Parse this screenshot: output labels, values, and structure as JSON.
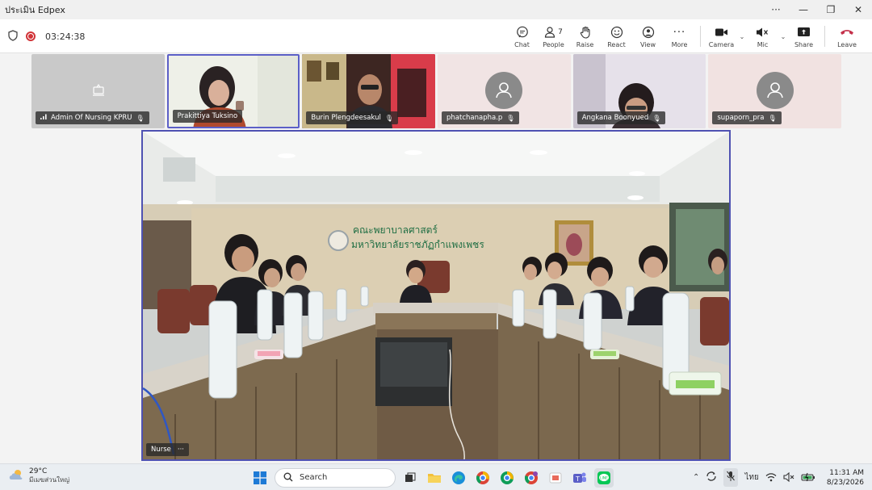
{
  "window": {
    "title": "ประเมิน Edpex",
    "controls": {
      "more": "···",
      "minimize": "—",
      "restore": "❐",
      "close": "✕"
    }
  },
  "toolbar": {
    "timer": "03:24:38",
    "chat_label": "Chat",
    "people_label": "People",
    "people_count": "7",
    "raise_label": "Raise",
    "react_label": "React",
    "view_label": "View",
    "more_label": "More",
    "camera_label": "Camera",
    "mic_label": "Mic",
    "share_label": "Share",
    "leave_label": "Leave",
    "leave_color": "#c4314b"
  },
  "participants": [
    {
      "name": "Admin Of Nursing KPRU",
      "type": "presenting-icon"
    },
    {
      "name": "Prakittiya Tuksino",
      "type": "video",
      "active": true
    },
    {
      "name": "Burin Plengdeesakul",
      "type": "video"
    },
    {
      "name": "phatchanapha.p",
      "type": "avatar"
    },
    {
      "name": "Angkana Boonyued",
      "type": "video"
    },
    {
      "name": "supaporn_pra",
      "type": "avatar"
    }
  ],
  "stage": {
    "name": "Nurse",
    "more": "···",
    "banner_line1": "คณะพยาบาลศาสตร์",
    "banner_line2": "มหาวิทยาลัยราชภัฏกำแพงเพชร"
  },
  "taskbar": {
    "temperature": "29°C",
    "condition": "มีเมฆส่วนใหญ่",
    "search_label": "Search",
    "language": "ไทย",
    "time": "11:31 AM",
    "date": "8/23/2026"
  }
}
